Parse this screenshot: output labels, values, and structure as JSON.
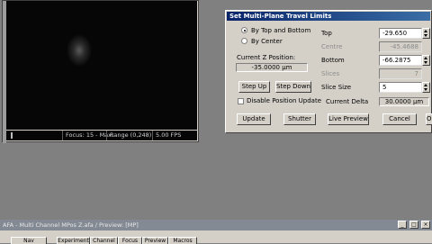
{
  "preview": {
    "status_focus": "Focus: 15 - Max:",
    "status_range": "Range (0,248)",
    "status_fps": "5.00 FPS"
  },
  "dialog": {
    "title": "Set Multi-Plane Travel Limits",
    "radio_top_bottom": "By Top and Bottom",
    "radio_center": "By Center",
    "current_z_label": "Current Z Position:",
    "current_z_value": "-35.0000 µm",
    "step_up": "Step Up",
    "step_down": "Step Down",
    "disable_position_update": "Disable Position Update",
    "top_label": "Top",
    "top_value": "-29.650",
    "centre_label": "Centre",
    "centre_value": "-45.4688",
    "bottom_label": "Bottom",
    "bottom_value": "-66.2875",
    "slices_label": "Slices",
    "slices_value": "7",
    "slice_size_label": "Slice Size",
    "slice_size_value": "5",
    "current_delta_label": "Current Delta",
    "current_delta_value": "30.0000 µm",
    "btn_update": "Update",
    "btn_shutter": "Shutter",
    "btn_live_preview": "Live Preview",
    "btn_cancel": "Cancel",
    "btn_ok": "OK"
  },
  "app": {
    "title": "AFA - Multi Channel MPos Z.afa / Preview: [MP]",
    "tabs": [
      "Nav",
      "Experiment",
      "Channel",
      "Focus",
      "Preview",
      "Macros"
    ]
  }
}
